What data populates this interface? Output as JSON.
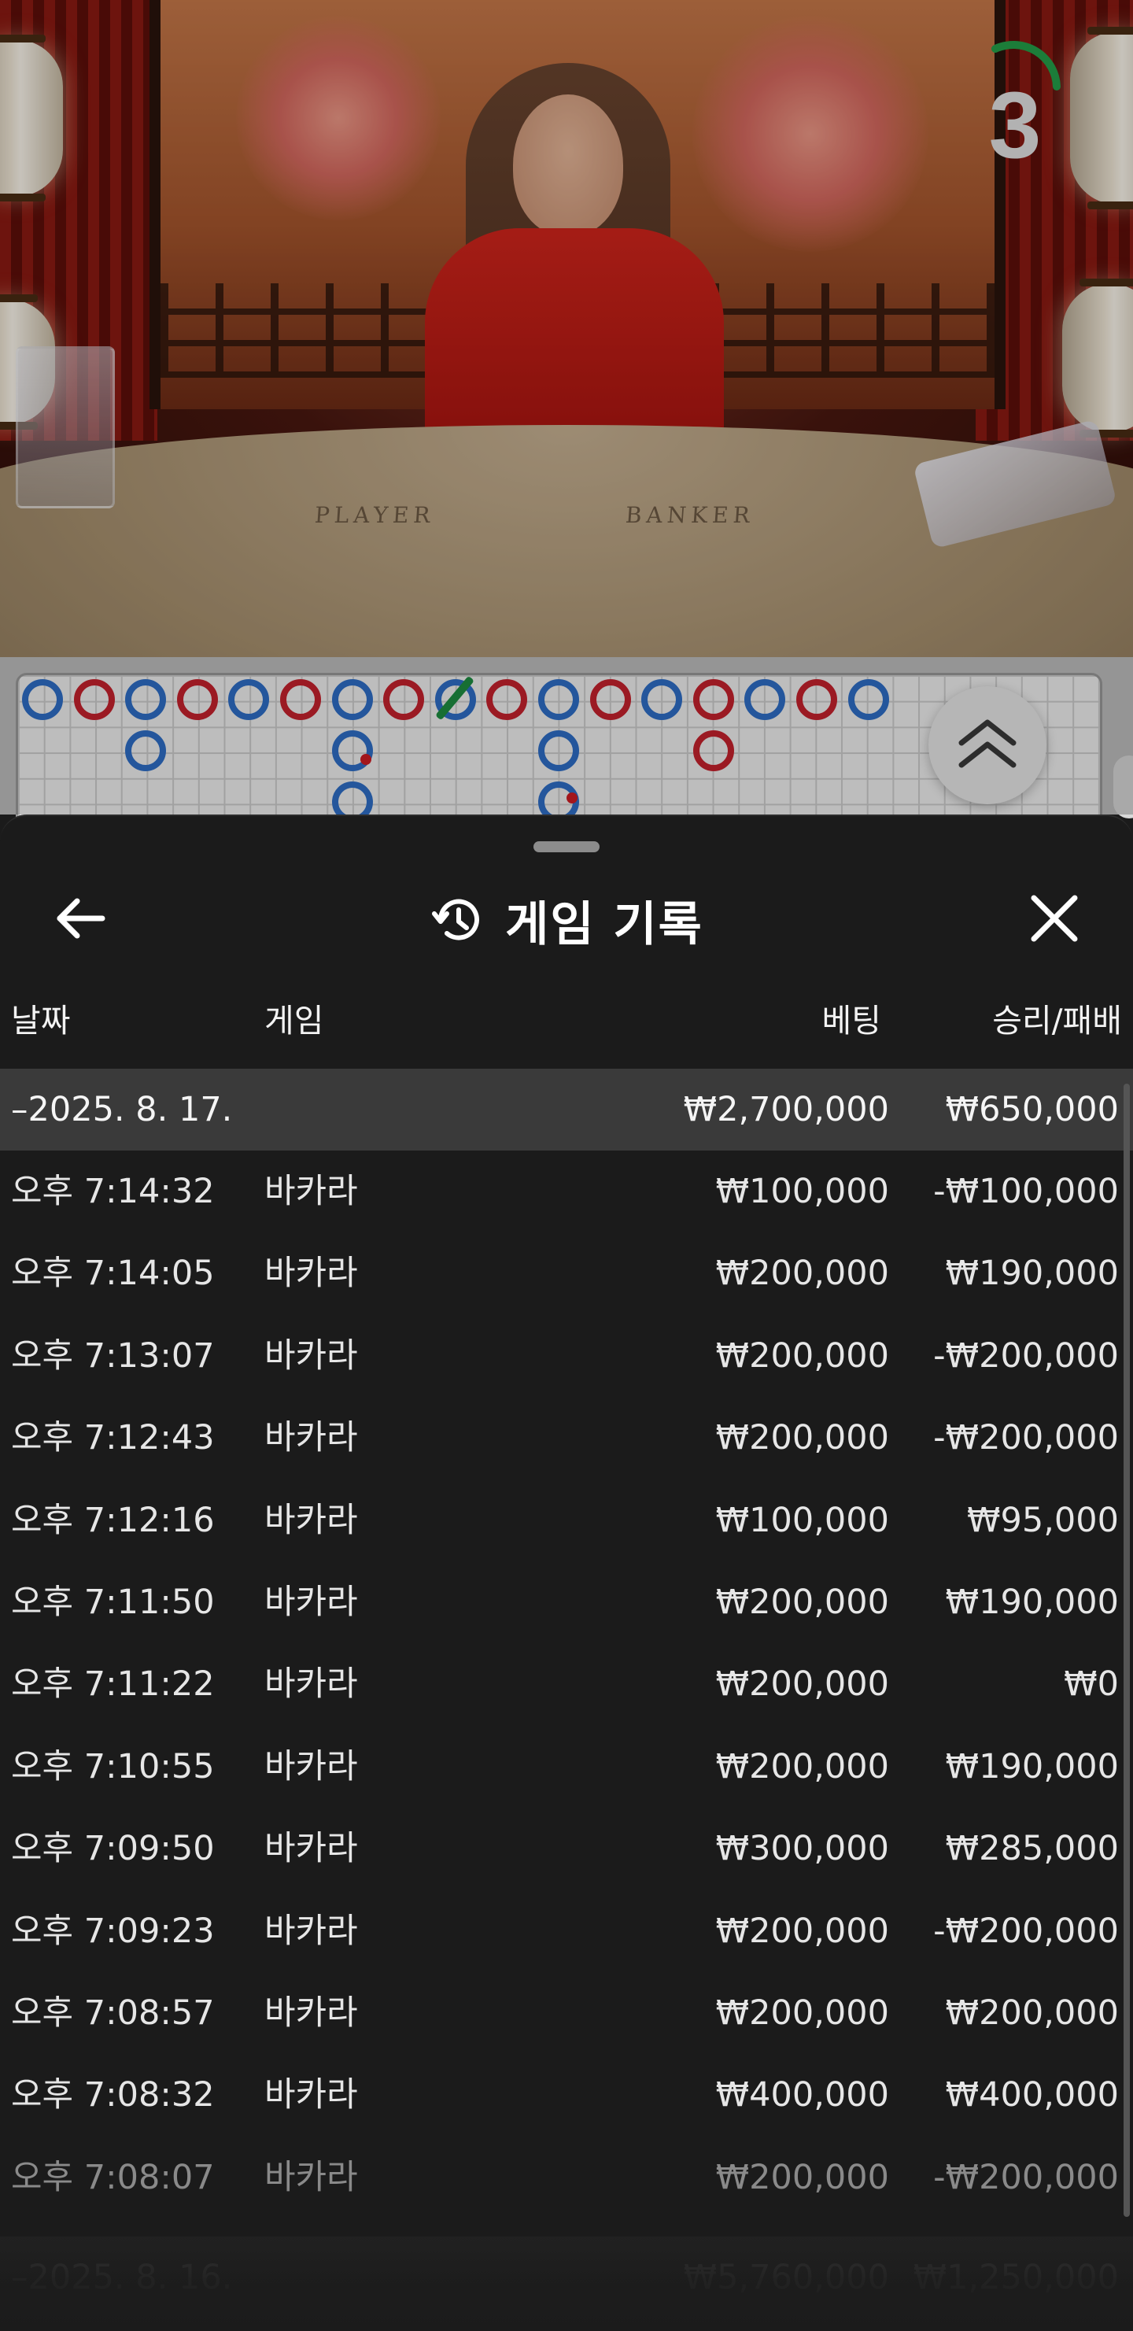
{
  "video": {
    "timer_value": "3",
    "table_labels": {
      "player": "PLAYER",
      "banker": "BANKER"
    }
  },
  "roadmap": {
    "colors": {
      "player": "#2f6fc8",
      "banker": "#c7222d",
      "tie": "#1e8f42"
    },
    "top_row": [
      "P",
      "B",
      "P",
      "B",
      "P",
      "B",
      "P",
      "B",
      "P",
      "B",
      "P",
      "B",
      "P",
      "B",
      "P",
      "B",
      "P"
    ],
    "second_row": [
      {
        "col": 2,
        "side": "P"
      },
      {
        "col": 6,
        "side": "P"
      },
      {
        "col": 10,
        "side": "P"
      },
      {
        "col": 13,
        "side": "B"
      }
    ],
    "third_row": [
      {
        "col": 6,
        "side": "P"
      },
      {
        "col": 10,
        "side": "P"
      }
    ]
  },
  "sheet": {
    "title": "게임 기록",
    "columns": {
      "date": "날짜",
      "game": "게임",
      "bet": "베팅",
      "result": "승리/패배"
    },
    "group": {
      "date": "–2025. 8. 17.",
      "bet": "₩2,700,000",
      "result": "₩650,000"
    },
    "rows": [
      {
        "time": "오후 7:14:32",
        "game": "바카라",
        "bet": "₩100,000",
        "result": "-₩100,000"
      },
      {
        "time": "오후 7:14:05",
        "game": "바카라",
        "bet": "₩200,000",
        "result": "₩190,000"
      },
      {
        "time": "오후 7:13:07",
        "game": "바카라",
        "bet": "₩200,000",
        "result": "-₩200,000"
      },
      {
        "time": "오후 7:12:43",
        "game": "바카라",
        "bet": "₩200,000",
        "result": "-₩200,000"
      },
      {
        "time": "오후 7:12:16",
        "game": "바카라",
        "bet": "₩100,000",
        "result": "₩95,000"
      },
      {
        "time": "오후 7:11:50",
        "game": "바카라",
        "bet": "₩200,000",
        "result": "₩190,000"
      },
      {
        "time": "오후 7:11:22",
        "game": "바카라",
        "bet": "₩200,000",
        "result": "₩0"
      },
      {
        "time": "오후 7:10:55",
        "game": "바카라",
        "bet": "₩200,000",
        "result": "₩190,000"
      },
      {
        "time": "오후 7:09:50",
        "game": "바카라",
        "bet": "₩300,000",
        "result": "₩285,000"
      },
      {
        "time": "오후 7:09:23",
        "game": "바카라",
        "bet": "₩200,000",
        "result": "-₩200,000"
      },
      {
        "time": "오후 7:08:57",
        "game": "바카라",
        "bet": "₩200,000",
        "result": "₩200,000"
      },
      {
        "time": "오후 7:08:32",
        "game": "바카라",
        "bet": "₩400,000",
        "result": "₩400,000"
      },
      {
        "time": "오후 7:08:07",
        "game": "바카라",
        "bet": "₩200,000",
        "result": "-₩200,000"
      }
    ],
    "next_group": {
      "date": "–2025. 8. 16.",
      "bet": "₩5,760,000",
      "result": "₩1,250,000"
    }
  }
}
